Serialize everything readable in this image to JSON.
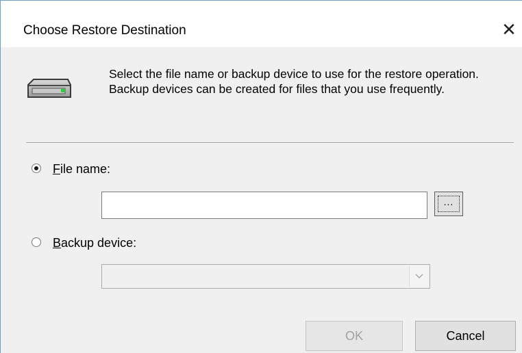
{
  "dialog": {
    "title": "Choose Restore Destination",
    "close_symbol": "✕",
    "icon": "backup-device-icon",
    "description": "Select the file name or backup device to use for the restore operation.  Backup devices can be created for files that you use frequently."
  },
  "options": {
    "file_name": {
      "accel": "F",
      "rest": "ile name:",
      "selected": true,
      "value": "",
      "browse_label": "..."
    },
    "backup_device": {
      "accel": "B",
      "rest": "ackup device:",
      "selected": false,
      "selected_value": "",
      "disabled": true
    }
  },
  "buttons": {
    "ok": "OK",
    "cancel": "Cancel"
  }
}
